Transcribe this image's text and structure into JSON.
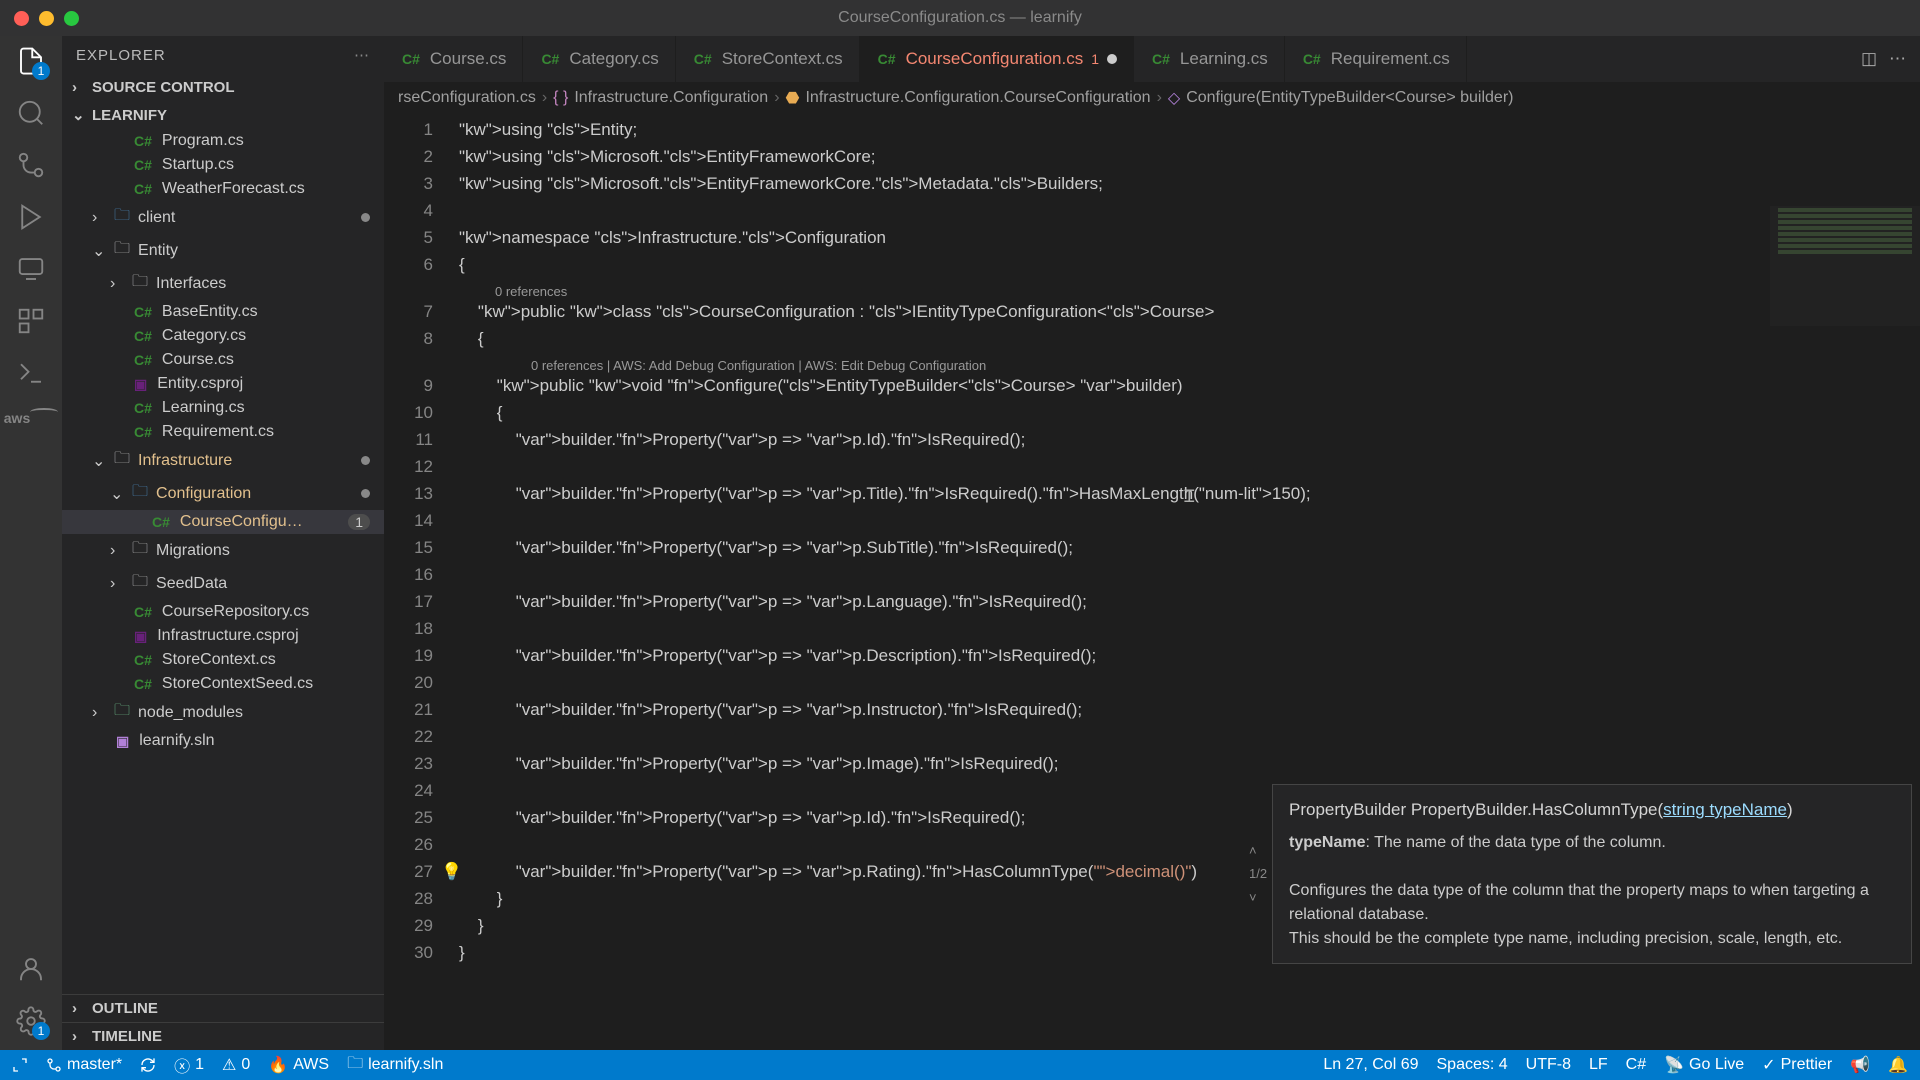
{
  "title": "CourseConfiguration.cs — learnify",
  "activity_badges": {
    "explorer": "1",
    "settings": "1"
  },
  "sidebar": {
    "header": "EXPLORER",
    "sections": {
      "source_control": "SOURCE CONTROL",
      "project": "LEARNIFY",
      "outline": "OUTLINE",
      "timeline": "TIMELINE"
    },
    "tree": [
      {
        "type": "file",
        "icon": "cs",
        "label": "Program.cs",
        "indent": 2
      },
      {
        "type": "file",
        "icon": "cs",
        "label": "Startup.cs",
        "indent": 2
      },
      {
        "type": "file",
        "icon": "cs",
        "label": "WeatherForecast.cs",
        "indent": 2
      },
      {
        "type": "folder",
        "open": false,
        "label": "client",
        "indent": 1,
        "mod": true,
        "blue": true
      },
      {
        "type": "folder",
        "open": true,
        "label": "Entity",
        "indent": 1
      },
      {
        "type": "folder",
        "open": false,
        "label": "Interfaces",
        "indent": 2
      },
      {
        "type": "file",
        "icon": "cs",
        "label": "BaseEntity.cs",
        "indent": 2
      },
      {
        "type": "file",
        "icon": "cs",
        "label": "Category.cs",
        "indent": 2
      },
      {
        "type": "file",
        "icon": "cs",
        "label": "Course.cs",
        "indent": 2
      },
      {
        "type": "file",
        "icon": "csproj",
        "label": "Entity.csproj",
        "indent": 2
      },
      {
        "type": "file",
        "icon": "cs",
        "label": "Learning.cs",
        "indent": 2
      },
      {
        "type": "file",
        "icon": "cs",
        "label": "Requirement.cs",
        "indent": 2
      },
      {
        "type": "folder",
        "open": true,
        "label": "Infrastructure",
        "indent": 1,
        "mod": true,
        "orange": true
      },
      {
        "type": "folder",
        "open": true,
        "label": "Configuration",
        "indent": 2,
        "mod": true,
        "orange": true,
        "blue": true
      },
      {
        "type": "file",
        "icon": "cs",
        "label": "CourseConfigu…",
        "indent": 3,
        "selected": true,
        "orange": true,
        "modnum": "1"
      },
      {
        "type": "folder",
        "open": false,
        "label": "Migrations",
        "indent": 2
      },
      {
        "type": "folder",
        "open": false,
        "label": "SeedData",
        "indent": 2
      },
      {
        "type": "file",
        "icon": "cs",
        "label": "CourseRepository.cs",
        "indent": 2
      },
      {
        "type": "file",
        "icon": "csproj",
        "label": "Infrastructure.csproj",
        "indent": 2
      },
      {
        "type": "file",
        "icon": "cs",
        "label": "StoreContext.cs",
        "indent": 2
      },
      {
        "type": "file",
        "icon": "cs",
        "label": "StoreContextSeed.cs",
        "indent": 2
      },
      {
        "type": "folder",
        "open": false,
        "label": "node_modules",
        "indent": 1,
        "green": true
      },
      {
        "type": "file",
        "icon": "sln",
        "label": "learnify.sln",
        "indent": 1
      }
    ]
  },
  "tabs": [
    {
      "label": "Course.cs",
      "icon": "cs"
    },
    {
      "label": "Category.cs",
      "icon": "cs"
    },
    {
      "label": "StoreContext.cs",
      "icon": "cs"
    },
    {
      "label": "CourseConfiguration.cs",
      "icon": "cs",
      "active": true,
      "errnum": "1",
      "dirty": true
    },
    {
      "label": "Learning.cs",
      "icon": "cs"
    },
    {
      "label": "Requirement.cs",
      "icon": "cs"
    }
  ],
  "breadcrumb": [
    "rseConfiguration.cs",
    "Infrastructure.Configuration",
    "Infrastructure.Configuration.CourseConfiguration",
    "Configure(EntityTypeBuilder<Course> builder)"
  ],
  "codelens": {
    "class": "0 references",
    "method": "0 references | AWS: Add Debug Configuration | AWS: Edit Debug Configuration"
  },
  "code_lines": [
    "using Entity;",
    "using Microsoft.EntityFrameworkCore;",
    "using Microsoft.EntityFrameworkCore.Metadata.Builders;",
    "",
    "namespace Infrastructure.Configuration",
    "{",
    "    public class CourseConfiguration : IEntityTypeConfiguration<Course>",
    "    {",
    "        public void Configure(EntityTypeBuilder<Course> builder)",
    "        {",
    "            builder.Property(p => p.Id).IsRequired();",
    "",
    "            builder.Property(p => p.Title).IsRequired().HasMaxLength(150);",
    "",
    "            builder.Property(p => p.SubTitle).IsRequired();",
    "",
    "            builder.Property(p => p.Language).IsRequired();",
    "",
    "            builder.Property(p => p.Description).IsRequired();",
    "",
    "            builder.Property(p => p.Instructor).IsRequired();",
    "",
    "            builder.Property(p => p.Image).IsRequired();",
    "",
    "            builder.Property(p => p.Id).IsRequired();",
    "",
    "            builder.Property(p => p.Rating).HasColumnType(\"decimal()\")",
    "        }",
    "    }",
    "}"
  ],
  "tooltip": {
    "sig_pre": "PropertyBuilder PropertyBuilder.HasColumnType(",
    "sig_param": "string typeName",
    "sig_post": ")",
    "counter": "1/2",
    "param_name": "typeName",
    "param_desc": ": The name of the data type of the column.",
    "desc1": "Configures the data type of the column that the property maps to when targeting a relational database.",
    "desc2": "This should be the complete type name, including precision, scale, length, etc."
  },
  "status": {
    "branch": "master*",
    "errors": "1",
    "warnings": "0",
    "aws": "AWS",
    "sln": "learnify.sln",
    "position": "Ln 27, Col 69",
    "spaces": "Spaces: 4",
    "encoding": "UTF-8",
    "eol": "LF",
    "lang": "C#",
    "golive": "Go Live",
    "prettier": "Prettier"
  }
}
